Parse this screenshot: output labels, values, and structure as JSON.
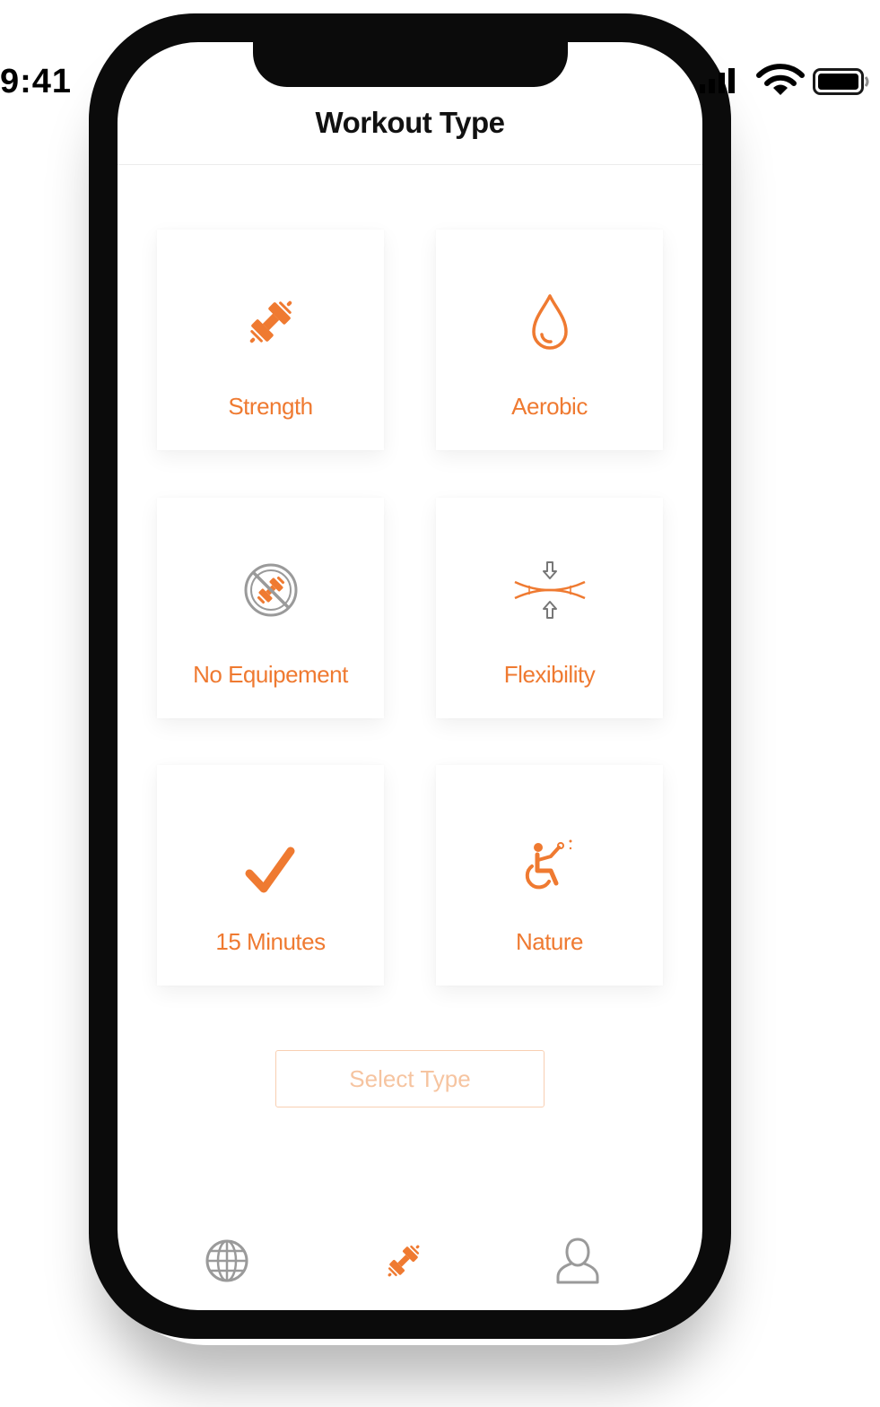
{
  "status_bar": {
    "time": "9:41",
    "icons": [
      "cellular-signal-icon",
      "wifi-icon",
      "battery-icon"
    ]
  },
  "nav": {
    "title": "Workout Type"
  },
  "workout_types": [
    {
      "label": "Strength",
      "icon": "dumbbell-icon"
    },
    {
      "label": "Aerobic",
      "icon": "water-drop-icon"
    },
    {
      "label": "No Equipement",
      "icon": "no-equipment-icon"
    },
    {
      "label": "Flexibility",
      "icon": "flexibility-icon"
    },
    {
      "label": "15 Minutes",
      "icon": "checkmark-icon"
    },
    {
      "label": "Nature",
      "icon": "wheelchair-icon"
    }
  ],
  "select_button": {
    "label": "Select Type"
  },
  "tab_bar": {
    "items": [
      {
        "icon": "globe-icon",
        "active": false
      },
      {
        "icon": "dumbbell-icon",
        "active": true
      },
      {
        "icon": "profile-icon",
        "active": false
      }
    ]
  },
  "colors": {
    "accent": "#ef7a31",
    "accent_light": "#f6c4a0",
    "inactive": "#9a9a9a"
  }
}
